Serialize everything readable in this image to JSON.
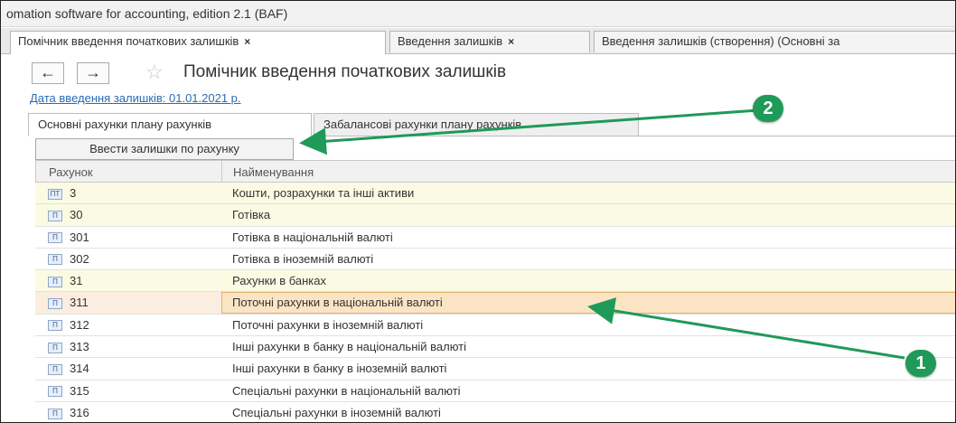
{
  "window": {
    "title": "omation software for accounting, edition 2.1  (BAF)"
  },
  "tabs": [
    {
      "label": "Помічник введення початкових залишків",
      "close": "×"
    },
    {
      "label": "Введення залишків",
      "close": "×"
    },
    {
      "label": "Введення залишків (створення) (Основні за"
    }
  ],
  "nav": {
    "back": "←",
    "forward": "→",
    "star": "☆"
  },
  "page": {
    "title": "Помічник введення початкових залишків",
    "date_link": "Дата введення залишків: 01.01.2021 р."
  },
  "subtabs": [
    {
      "label": "Основні рахунки плану рахунків"
    },
    {
      "label": "Забалансові рахунки плану рахунків"
    }
  ],
  "toolbar": {
    "enter_button": "Ввести залишки по рахунку"
  },
  "table": {
    "columns": [
      "Рахунок",
      "Найменування"
    ],
    "rows": [
      {
        "code": "3",
        "name": "Кошти, розрахунки та інші активи",
        "icon": "ПТ"
      },
      {
        "code": "30",
        "name": "Готівка",
        "icon": "П"
      },
      {
        "code": "301",
        "name": "Готівка в національній валюті",
        "icon": "П"
      },
      {
        "code": "302",
        "name": "Готівка в іноземній валюті",
        "icon": "П"
      },
      {
        "code": "31",
        "name": "Рахунки в банках",
        "icon": "П"
      },
      {
        "code": "311",
        "name": "Поточні рахунки в національній валюті",
        "icon": "П"
      },
      {
        "code": "312",
        "name": "Поточні рахунки в іноземній валюті",
        "icon": "П"
      },
      {
        "code": "313",
        "name": "Інші рахунки в банку в національній валюті",
        "icon": "П"
      },
      {
        "code": "314",
        "name": "Інші рахунки в банку в іноземній валюті",
        "icon": "П"
      },
      {
        "code": "315",
        "name": "Спеціальні рахунки в національній валюті",
        "icon": "П"
      },
      {
        "code": "316",
        "name": "Спеціальні рахунки в іноземній валюті",
        "icon": "П"
      }
    ]
  },
  "annotations": {
    "badge_1": "1",
    "badge_2": "2",
    "color": "#1f9a58"
  }
}
